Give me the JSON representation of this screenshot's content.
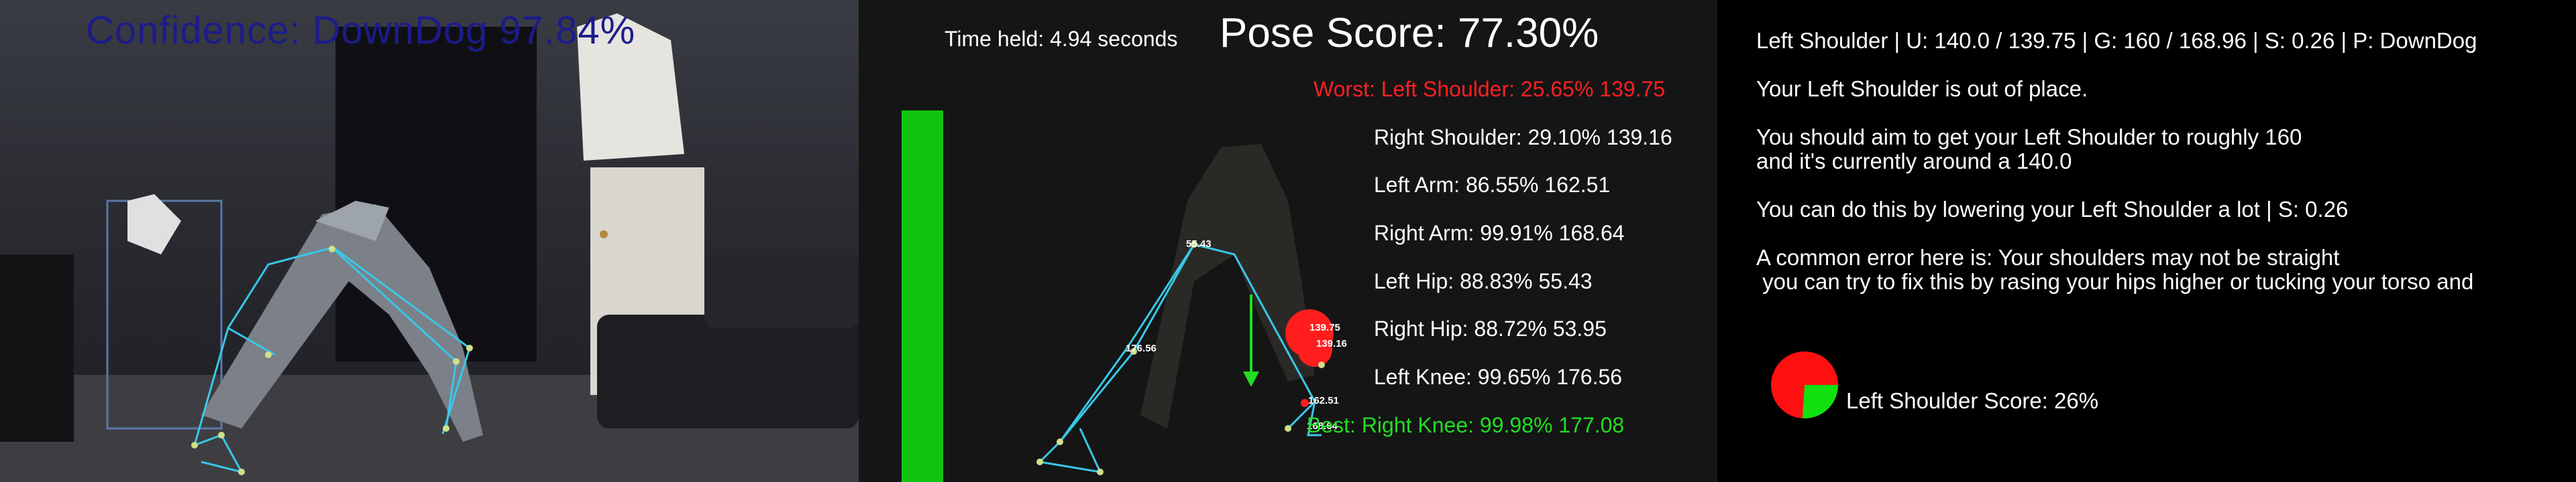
{
  "camera": {
    "confidence_text": "Confidence: DownDog 97.84%",
    "text_color": "#1c1c8a"
  },
  "analysis": {
    "time_held": "Time held: 4.94 seconds",
    "pose_score": "Pose Score: 77.30%",
    "hold_bar_color": "#12c412",
    "worst": "Worst: Left Shoulder: 25.65% 139.75",
    "joints": [
      "Right Shoulder: 29.10% 139.16",
      "Left Arm: 86.55% 162.51",
      "Right Arm: 99.91% 168.64",
      "Left Hip: 88.83% 55.43",
      "Right Hip: 88.72% 53.95",
      "Left Knee: 99.65% 176.56"
    ],
    "best": "Best: Right Knee: 99.98% 177.08",
    "worst_color": "#ff2020",
    "best_color": "#22dd22",
    "skeleton_labels": [
      "55.43",
      "176.56",
      "139.75",
      "139.16",
      "162.51",
      "168.64"
    ]
  },
  "feedback": {
    "header": "Left Shoulder | U: 140.0 / 139.75 | G: 160 / 168.96 | S: 0.26 | P: DownDog",
    "lines": [
      "Your Left Shoulder is out of place.",
      "You should aim to get your Left Shoulder to roughly 160",
      "and it's currently around a 140.0",
      "You can do this by lowering your Left Shoulder a lot | S: 0.26",
      "A common error here is: Your shoulders may not be straight",
      " you can try to fix this by rasing your hips higher or tucking your torso and"
    ],
    "score_label": "Left Shoulder Score: 26%",
    "score_fraction": 0.26,
    "pie_colors": {
      "bad": "#ff1010",
      "good": "#10e010"
    }
  }
}
